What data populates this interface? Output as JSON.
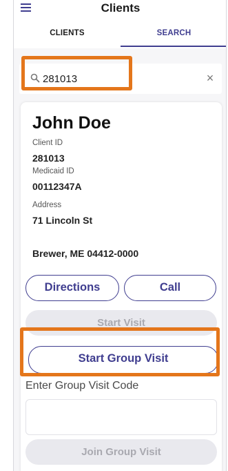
{
  "header": {
    "title": "Clients"
  },
  "tabs": [
    {
      "label": "CLIENTS",
      "active": false
    },
    {
      "label": "SEARCH",
      "active": true
    }
  ],
  "search": {
    "value": "281013",
    "placeholder": ""
  },
  "client": {
    "name": "John Doe",
    "client_id_label": "Client ID",
    "client_id": "281013",
    "medicaid_id_label": "Medicaid ID",
    "medicaid_id": "00112347A",
    "address_label": "Address",
    "address_line1": "71 Lincoln St",
    "address_line2": "Brewer, ME 04412-0000"
  },
  "actions": {
    "directions_label": "Directions",
    "call_label": "Call",
    "start_visit_label": "Start Visit",
    "start_group_visit_label": "Start Group Visit",
    "group_code_label": "Enter Group Visit Code",
    "group_code_value": "",
    "join_group_visit_label": "Join Group Visit"
  },
  "colors": {
    "accent": "#3f3d8f",
    "highlight": "#e4761b",
    "disabled_bg": "#e9e9ee",
    "disabled_text": "#a9a9b0"
  },
  "icons": {
    "menu": "hamburger-icon",
    "search": "search-icon",
    "clear": "close-icon"
  }
}
